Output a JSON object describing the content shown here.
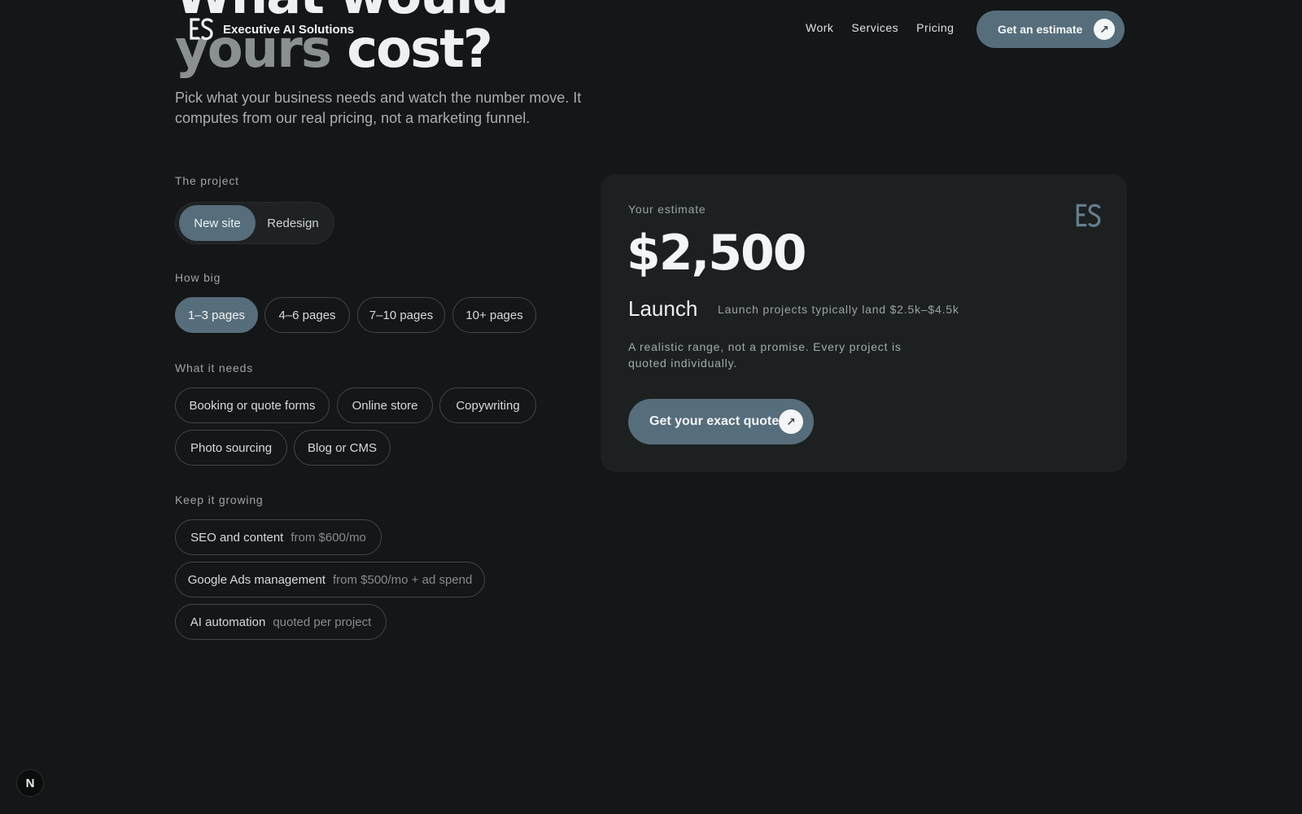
{
  "hero": {
    "title_line1": "What would",
    "title_line2_a": "yours",
    "title_line2_b": " cost?",
    "subtitle": "Pick what your business needs and watch the number move. It computes from our real pricing, not a marketing funnel."
  },
  "header": {
    "brand": "Executive AI Solutions",
    "nav": [
      "Work",
      "Services",
      "Pricing"
    ],
    "cta": "Get an estimate"
  },
  "form": {
    "project": {
      "label": "The project",
      "options": [
        "New site",
        "Redesign"
      ],
      "selected": "New site"
    },
    "size": {
      "label": "How big",
      "options": [
        "1–3 pages",
        "4–6 pages",
        "7–10 pages",
        "10+ pages"
      ],
      "selected": "1–3 pages"
    },
    "needs": {
      "label": "What it needs",
      "options": [
        "Booking or quote forms",
        "Online store",
        "Copywriting",
        "Photo sourcing",
        "Blog or CMS"
      ]
    },
    "growing": {
      "label": "Keep it growing",
      "options": [
        {
          "name": "SEO and content",
          "price": "from $600/mo"
        },
        {
          "name": "Google Ads management",
          "price": "from $500/mo + ad spend"
        },
        {
          "name": "AI automation",
          "price": "quoted per project"
        }
      ]
    }
  },
  "estimate": {
    "label": "Your estimate",
    "price": "$2,500",
    "tier": "Launch",
    "tier_note": "Launch projects typically land $2.5k–$4.5k",
    "disclaimer": "A realistic range, not a promise. Every project is quoted individually.",
    "cta": "Get your exact quote"
  },
  "badge": "N",
  "colors": {
    "background": "#141617",
    "card": "#1d2021",
    "accent": "#566d7b",
    "text": "#e6e8e9",
    "muted": "#9ba1a5"
  },
  "icons": {
    "brand": "ea-monogram-icon",
    "cta_arrow": "arrow-up-right-icon"
  }
}
